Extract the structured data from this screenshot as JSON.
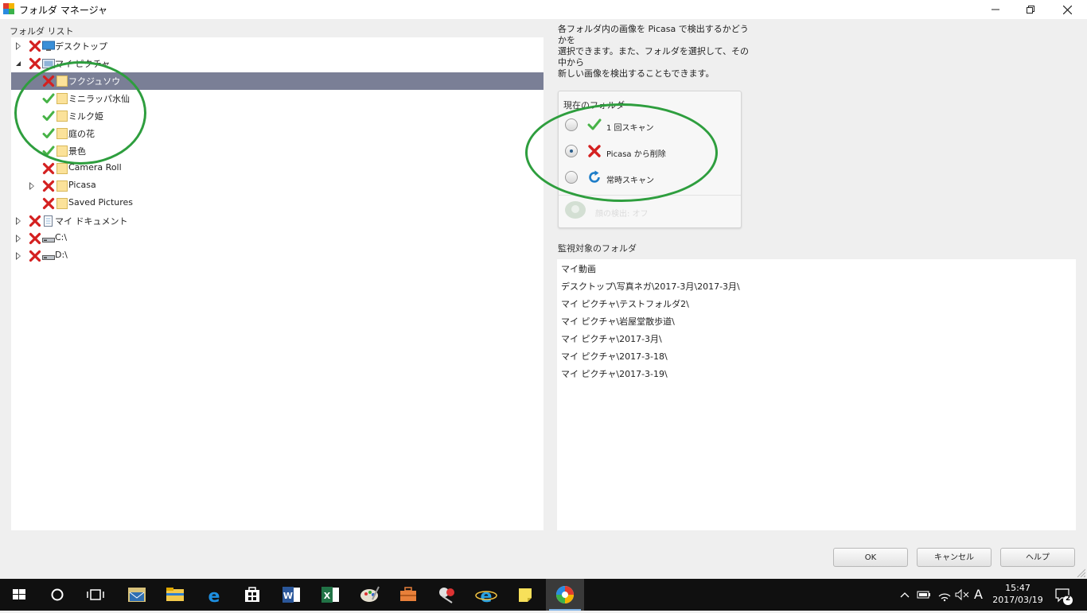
{
  "window": {
    "title": "フォルダ マネージャ",
    "minimize_icon": "minimize-icon",
    "maximize_icon": "restore-icon",
    "close_icon": "close-icon"
  },
  "folder_list": {
    "label": "フォルダ リスト",
    "items": [
      {
        "label": "デスクトップ",
        "status": "excluded",
        "icon": "desktop-icon",
        "expander": "closed",
        "selected": false
      },
      {
        "label": "マイ ピクチャ",
        "status": "excluded",
        "icon": "pictures-icon",
        "expander": "open",
        "selected": false
      },
      {
        "label": "フクジュソウ",
        "status": "excluded",
        "icon": "folder-icon",
        "expander": "",
        "selected": true
      },
      {
        "label": "ミニラッパ水仙",
        "status": "scan-once",
        "icon": "folder-icon",
        "expander": "",
        "selected": false
      },
      {
        "label": "ミルク姫",
        "status": "scan-once",
        "icon": "folder-icon",
        "expander": "",
        "selected": false
      },
      {
        "label": "庭の花",
        "status": "scan-once",
        "icon": "folder-icon",
        "expander": "",
        "selected": false
      },
      {
        "label": "景色",
        "status": "scan-once",
        "icon": "folder-icon",
        "expander": "",
        "selected": false
      },
      {
        "label": "Camera Roll",
        "status": "excluded",
        "icon": "folder-icon",
        "expander": "",
        "selected": false
      },
      {
        "label": "Picasa",
        "status": "excluded",
        "icon": "folder-icon",
        "expander": "closed",
        "selected": false
      },
      {
        "label": "Saved Pictures",
        "status": "excluded",
        "icon": "folder-icon",
        "expander": "",
        "selected": false
      },
      {
        "label": "マイ ドキュメント",
        "status": "excluded",
        "icon": "documents-icon",
        "expander": "closed",
        "selected": false
      },
      {
        "label": "C:\\",
        "status": "excluded",
        "icon": "drive-icon",
        "expander": "closed",
        "selected": false
      },
      {
        "label": "D:\\",
        "status": "excluded",
        "icon": "drive-icon",
        "expander": "closed",
        "selected": false
      }
    ]
  },
  "description": {
    "line1": "各フォルダ内の画像を Picasa で検出するかどうかを",
    "line2": "選択できます。また、フォルダを選択して、その中から",
    "line3": "新しい画像を検出することもできます。"
  },
  "current_folder": {
    "label": "現在のフォルダ",
    "options": [
      {
        "label": "1 回スキャン",
        "icon": "check-icon",
        "checked": false
      },
      {
        "label": "Picasa から削除",
        "icon": "x-icon",
        "checked": true
      },
      {
        "label": "常時スキャン",
        "icon": "refresh-icon",
        "checked": false
      }
    ],
    "faded_label": "顔の検出: オフ",
    "faded_icon": "face-detection-icon"
  },
  "watched": {
    "label": "監視対象のフォルダ",
    "items": [
      "マイ動画",
      "デスクトップ\\写真ネガ\\2017-3月\\2017-3月\\",
      "マイ ピクチャ\\テストフォルダ2\\",
      "マイ ピクチャ\\岩屋堂散歩道\\",
      "マイ ピクチャ\\2017-3月\\",
      "マイ ピクチャ\\2017-3-18\\",
      "マイ ピクチャ\\2017-3-19\\"
    ]
  },
  "buttons": {
    "ok": "OK",
    "cancel": "キャンセル",
    "help": "ヘルプ"
  },
  "taskbar": {
    "items": [
      "start-icon",
      "cortana-icon",
      "task-view-icon",
      "mail-icon",
      "file-explorer-icon",
      "edge-icon",
      "store-icon",
      "word-icon",
      "excel-icon",
      "paint-icon",
      "toolbox-icon",
      "snipping-icon",
      "internet-explorer-icon",
      "sticky-notes-icon",
      "picasa-icon"
    ],
    "tray_icons": [
      "chevron-up-icon",
      "battery-icon",
      "wifi-icon",
      "volume-mute-icon",
      "ime-icon"
    ],
    "ime_label": "A",
    "time": "15:47",
    "date": "2017/03/19",
    "notification_count": "2"
  },
  "colors": {
    "selection": "#7a7f96",
    "check": "#47b347",
    "x": "#d42020",
    "annotation": "#2e9e3e"
  }
}
